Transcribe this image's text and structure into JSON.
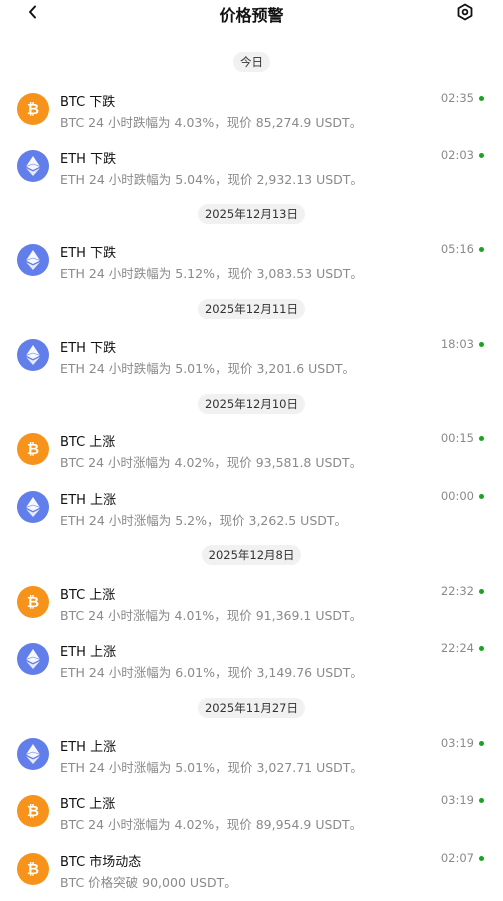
{
  "header": {
    "title": "价格预警",
    "back_icon": "chevron-left-icon",
    "settings_icon": "gear-icon"
  },
  "colors": {
    "btc": "#f7931a",
    "eth": "#627eea",
    "unread": "#1aa320"
  },
  "groups": [
    {
      "date": "今日",
      "alerts": [
        {
          "coin": "btc",
          "title": "BTC 下跌",
          "desc": "BTC 24 小时跌幅为 4.03%，现价 85,274.9 USDT。",
          "time": "02:35"
        },
        {
          "coin": "eth",
          "title": "ETH 下跌",
          "desc": "ETH 24 小时跌幅为 5.04%，现价 2,932.13 USDT。",
          "time": "02:03"
        }
      ]
    },
    {
      "date": "2025年12月13日",
      "alerts": [
        {
          "coin": "eth",
          "title": "ETH 下跌",
          "desc": "ETH 24 小时跌幅为 5.12%，现价 3,083.53 USDT。",
          "time": "05:16"
        }
      ]
    },
    {
      "date": "2025年12月11日",
      "alerts": [
        {
          "coin": "eth",
          "title": "ETH 下跌",
          "desc": "ETH 24 小时跌幅为 5.01%，现价 3,201.6 USDT。",
          "time": "18:03"
        }
      ]
    },
    {
      "date": "2025年12月10日",
      "alerts": [
        {
          "coin": "btc",
          "title": "BTC 上涨",
          "desc": "BTC 24 小时涨幅为 4.02%，现价 93,581.8 USDT。",
          "time": "00:15"
        },
        {
          "coin": "eth",
          "title": "ETH 上涨",
          "desc": "ETH 24 小时涨幅为 5.2%，现价 3,262.5 USDT。",
          "time": "00:00"
        }
      ]
    },
    {
      "date": "2025年12月8日",
      "alerts": [
        {
          "coin": "btc",
          "title": "BTC 上涨",
          "desc": "BTC 24 小时涨幅为 4.01%，现价 91,369.1 USDT。",
          "time": "22:32"
        },
        {
          "coin": "eth",
          "title": "ETH 上涨",
          "desc": "ETH 24 小时涨幅为 6.01%，现价 3,149.76 USDT。",
          "time": "22:24"
        }
      ]
    },
    {
      "date": "2025年11月27日",
      "alerts": [
        {
          "coin": "eth",
          "title": "ETH 上涨",
          "desc": "ETH 24 小时涨幅为 5.01%，现价 3,027.71 USDT。",
          "time": "03:19"
        },
        {
          "coin": "btc",
          "title": "BTC 上涨",
          "desc": "BTC 24 小时涨幅为 4.02%，现价 89,954.9 USDT。",
          "time": "03:19"
        },
        {
          "coin": "btc",
          "title": "BTC 市场动态",
          "desc": "BTC 价格突破 90,000 USDT。",
          "time": "02:07"
        }
      ]
    }
  ]
}
